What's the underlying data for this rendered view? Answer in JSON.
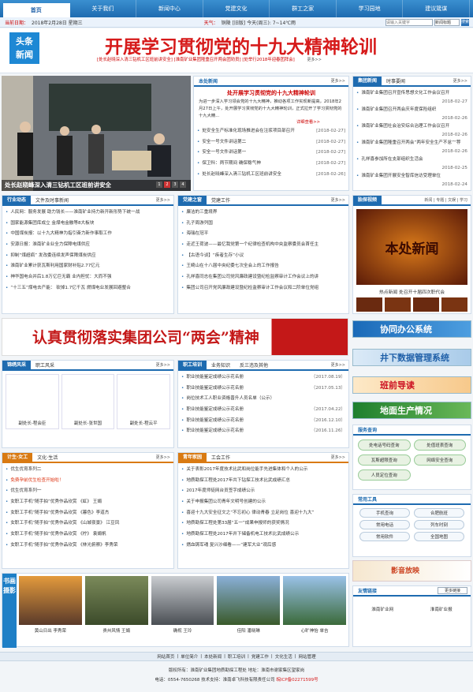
{
  "nav": [
    "首页",
    "关于我们",
    "新闻中心",
    "党建文化",
    "群工之家",
    "学习园地",
    "建议箴谋"
  ],
  "bar": {
    "date_label": "当前日期：",
    "date": "2018年2月28日 星期三",
    "weather_label": "天气：",
    "weather": "铜陵 [旧版] 今天(周三): 7~14℃雨"
  },
  "search": {
    "placeholder": "请输入关键字",
    "scope": "新闻标题",
    "button": "搜索"
  },
  "logo": [
    "头条",
    "新闻"
  ],
  "headline": "开展学习贯彻党的十九大精神轮训",
  "subline": "[处长赵晓深入清三钻机工区班前讲安全] [淮南矿业集团隆重召开两会团劝员] [处举行2018年迎春团拜会]",
  "subline_more": "更多>>",
  "photo_caption": "处长赵晓峰深入清三钻机工区班前讲安全",
  "photo_pages": [
    "1",
    "2",
    "3",
    "4"
  ],
  "news": {
    "title": "本处新闻",
    "more": "更多>>",
    "headline": "处开展学习贯彻党的十九大精神轮训",
    "summary": "为进一步深入学习领会党的十九大精神，推动各项工作实现新提高，2018年2月27日上午，处开展学习贯彻党的十九大精神轮训，正式拉开了学习贯彻党的十九大精...",
    "detail": "详细查看>>",
    "items": [
      [
        "处安全生产标准化现场推进会在注浆项目部召开",
        "[2018-02-27]"
      ],
      [
        "安全一号文件讲话第二",
        "[2018-02-27]"
      ],
      [
        "安全一号文件讲话第一",
        "[2018-02-27]"
      ],
      [
        "保卫科：两节期间 确保稳气神",
        "[2018-02-27]"
      ],
      [
        "处长赵晓峰深入清三钻机工区班前讲安全",
        "[2018-02-26]"
      ]
    ]
  },
  "group": {
    "tabs": [
      "集团新闻",
      "时事要闻"
    ],
    "more": "更多>>",
    "items": [
      [
        "淮南矿业集团召开宣传思想文化工作会议召开",
        "2018-02-27"
      ],
      [
        "淮南矿业集团召开两会庆年度保险组织",
        "2018-02-26"
      ],
      [
        "淮南矿业集团社会治安综合治理工作会议召开",
        "2018-02-26"
      ],
      [
        "淮南矿业集团隆重召开两会“两年安全生产不怠”“荐",
        "2018-02-26"
      ],
      [
        "孔祥喜参加所在支部组织生活会",
        "2018-02-25"
      ],
      [
        "淮南矿业集团开展安全智库信访受理单位",
        "2018-02-24"
      ]
    ]
  },
  "industry": {
    "tabs": [
      "行业动态",
      "文件及时事新闻"
    ],
    "more": "更多>>",
    "items": [
      "人民网：服务发展 助力钱长——淮南矿业持力新开新形势下统一战",
      "国家能源集团库成立 金煤电金融等8大板块",
      "中国煤炭报：以十九大精神为指引奋力新作事取工作",
      "安源日报：淮南矿业业全力保障电煤供应",
      "抑制“煤超疯” 发改委连续发声保障煤炭供应",
      "淮南矿业累计获瓦斯利用国家财补贴2.77亿元",
      "神华国电合并后1.8万亿巨无霸 业内担忧：大而不强",
      "“十三五”煤电去产能： 砍掉1.7亿千瓦 燃煤电业发展回避整合"
    ]
  },
  "party": {
    "tabs": [
      "党建之窗",
      "党建工作"
    ],
    "more": "更多>>",
    "items": [
      "廉洁的三重境界",
      "孔子周游列国",
      "海瑞在冠平",
      "走近王荷波——最忆我党第一个纪律检查机构中央监察委员会首任主",
      "【古语今谈】“疾者生存”小议",
      "王崎山在十八届中央纪委七次全会上的工作报告",
      "孔祥喜同志在集团公司党风廉政建设暨纪检监察审计工作会议上的讲",
      "集团公司召开党风廉政建设暨纪检监察审计工作会议和二阶单位党组"
    ]
  },
  "video": {
    "tabs": [
      "胎探视频"
    ],
    "links": "新闻 | 专题 | 文娱 | 学习",
    "screen": "本处新闻",
    "caption": "热点新闻 处召开十届四次职代会"
  },
  "banner": "认真贯彻落实集团公司“两会”精神",
  "sidebanners": [
    "协同办公系统",
    "井下数据管理系统",
    "班前导读",
    "地面生产情况"
  ],
  "style": {
    "tabs": [
      "锦绣风采",
      "职工风采"
    ],
    "more": "更多>>",
    "thumbs": [
      "副处长-程会臣",
      "副处长-张世国",
      "副处长-程云平"
    ]
  },
  "training": {
    "tabs": [
      "职工培训",
      "业务知识",
      "反三违及其他"
    ],
    "more": "更多>>",
    "items": [
      [
        "职业技能鉴定成绩公示花名册",
        "（2017.08.19）"
      ],
      [
        "职业技能鉴定成绩公示花名册",
        "（2017.05.13）"
      ],
      [
        "岗位技术工人职业资格晋升人员名单（公示）",
        ""
      ],
      [
        "职业技能鉴定成绩公示花名册",
        "（2017.04.22）"
      ],
      [
        "职业技能鉴定成绩公示花名册",
        "（2016.12.10）"
      ],
      [
        "职业技能鉴定成绩公示花名册",
        "（2016.11.26）"
      ]
    ]
  },
  "service": {
    "title": "服务查询",
    "items": [
      "处电话号码查询",
      "处值班表查询",
      "瓦斯超限查询",
      "网络安全查询",
      "人员定位查询"
    ]
  },
  "culture": {
    "tabs": [
      "计生·女工",
      "文化·生活"
    ],
    "more": "更多>>",
    "items": [
      "优生优育系列二",
      "免费孕前优生检查开始啦！",
      "优生优育系列一",
      "女职工手机“随手拍”优秀作品欣赏 《虹》 王娟",
      "女职工手机“随手拍”优秀作品欣赏 《暮色》李道杰",
      "女职工手机“随手拍”优秀作品欣赏 《山城夜景》 江豆凤",
      "女职工手机“随手拍”优秀作品欣赏 《柠》 袁娟帆",
      "女职工手机“随手拍”优秀作品欣赏 《林光俯察》李秀荣"
    ]
  },
  "youth": {
    "tabs": [
      "青年家园",
      "工会工作"
    ],
    "more": "更多>>",
    "items": [
      "关于表彰2017年度技术比武和岗位能手先进集体和个人的公示",
      "地质勘探工程处2017年共下钻探工技术比武成绩汇总",
      "2017年度师徒网台员签字成绩公示",
      "关于申报集团公司青年文明号创建的公示",
      "喜迎十九大安全征文之“不忘初心 律动青春 立足岗位 喜迎十九大”",
      "地质勘探工程处第33届“五一”成果申报师的获奖情况",
      "地质勘探工程处2017年井下储备机电工技术比武成绩公示",
      "燃血铸军魂 复兴沙细看——“建军大业”观后感"
    ]
  },
  "tools": {
    "title": "常用工具",
    "items": [
      "手机查询",
      "合肥航班",
      "常用电话",
      "列车时刻",
      "常用软件",
      "全国地图"
    ]
  },
  "movies": "影音放映",
  "scenery": {
    "title": "书画摄影",
    "items": [
      "黄山日出 李秀荣",
      "贵州风情 王娟",
      "确视 王玲",
      "佳阳 潘晓琳",
      "心旷神怡 单吉"
    ]
  },
  "links": {
    "title": "友情链接",
    "select": "更多链接",
    "items": [
      "淮南矿业网",
      "淮南矿业报"
    ]
  },
  "footer": {
    "links": [
      "网站首页",
      "单位简介",
      "本处新闻",
      "职工培训",
      "党建工作",
      "文化生活",
      "网站管理"
    ],
    "line1": "版权所有：淮南矿业集团地质勘探工程处  地址：淮南市谢家集区望家岗",
    "line2": "电话：0554-7650268  技术支持：淮南卓飞科技有限责任公司",
    "icp": "皖ICP备02271599号",
    "colors": {
      "red": "#d61a1a",
      "blue": "#1e6bb0"
    }
  }
}
